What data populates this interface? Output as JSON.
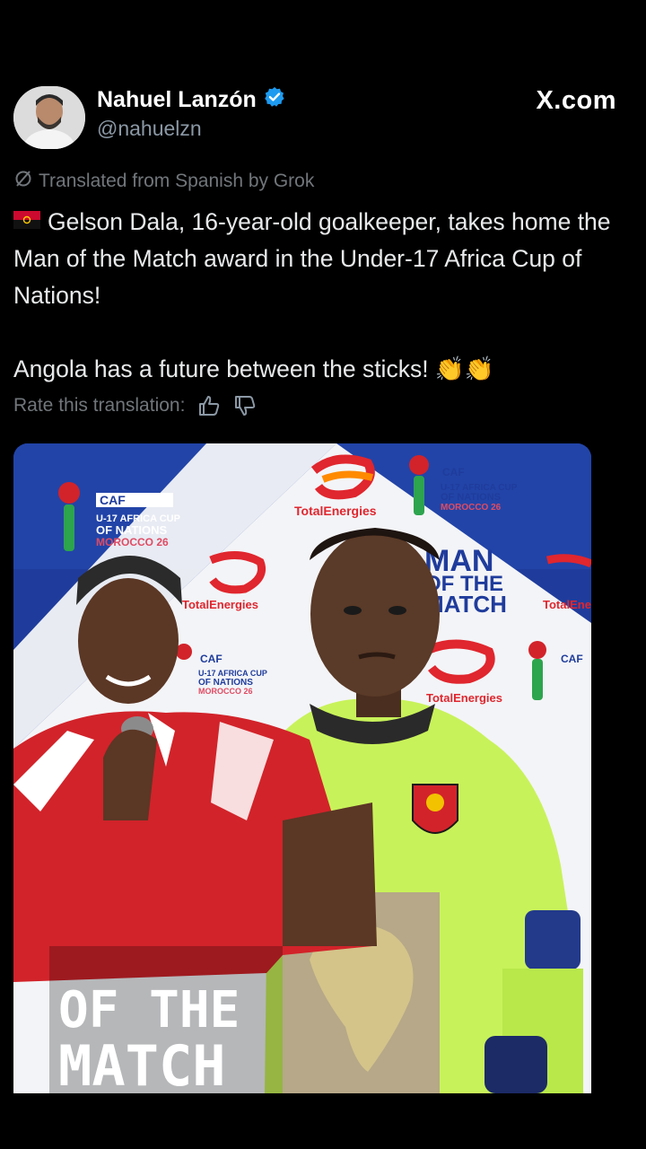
{
  "author": {
    "name": "Nahuel Lanzón",
    "handle": "@nahuelzn",
    "verified_icon": "verified-badge-icon",
    "avatar_icon": "avatar"
  },
  "brand": "X.com",
  "translation_note": "Translated from Spanish by Grok",
  "tweet": {
    "line1": "Gelson Dala, 16-year-old goalkeeper, takes home the Man of the Match award in the Under-17 Africa Cup of Nations!",
    "line2": "Angola has a future between the sticks! 👏👏"
  },
  "rate": {
    "label": "Rate this translation:",
    "up_icon": "thumbs-up-icon",
    "down_icon": "thumbs-down-icon"
  },
  "media": {
    "caf": "CAF",
    "cup1": "U-17 AFRICA CUP",
    "cup2": "OF NATIONS",
    "cup3": "MOROCCO 26",
    "sponsor": "TotalEnergies",
    "motm1": "MAN",
    "motm2": "OF THE",
    "motm3": "MATCH",
    "bottom1": "OF THE",
    "bottom2": "MATCH"
  },
  "colors": {
    "accent_blue": "#1d9bf0",
    "poster_blue": "#1f3c9c",
    "jersey_green": "#c8f25a",
    "shirt_red": "#d2232a"
  }
}
